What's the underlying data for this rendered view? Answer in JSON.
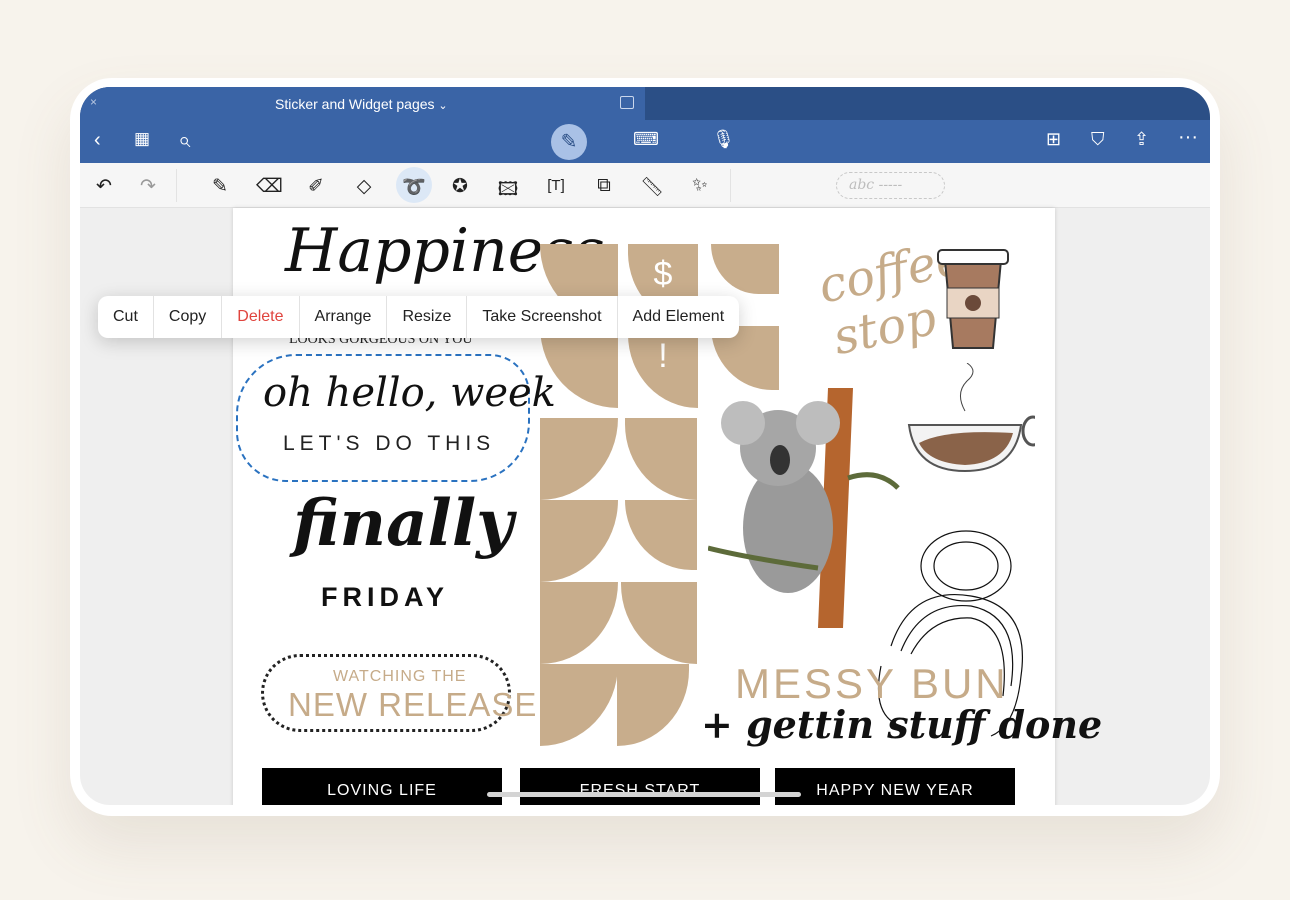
{
  "window": {
    "title": "Sticker and Widget pages",
    "title_chevron": "⌄",
    "close": "×"
  },
  "colors": {
    "header_blue": "#3a64a6",
    "titlebar_dark": "#2b4f86",
    "accent_tan": "#c8ad8c",
    "delete_red": "#e0443e"
  },
  "navbar": {
    "icons": [
      "back-icon",
      "grid-icon",
      "search-icon",
      "pen-write-icon",
      "keyboard-icon",
      "microphone-icon",
      "new-page-icon",
      "bookmark-icon",
      "share-icon",
      "more-icon"
    ]
  },
  "toolbar": {
    "tools": [
      "undo",
      "redo",
      "pen",
      "eraser",
      "highlighter",
      "shapes",
      "lasso",
      "sticker",
      "image",
      "text-box",
      "image-search",
      "ruler",
      "laser-pointer"
    ],
    "handwriting_placeholder": "abc -----"
  },
  "context_menu": {
    "items": [
      "Cut",
      "Copy",
      "Delete",
      "Arrange",
      "Resize",
      "Take Screenshot",
      "Add Element"
    ]
  },
  "page": {
    "happiness": "Happiness",
    "looks": "LOOKS GORGEOUS ON YOU",
    "hello": "oh hello, week",
    "lets": "LET'S DO THIS",
    "finally": "finally",
    "friday": "FRIDAY",
    "watching": "WATCHING THE",
    "release": "NEW RELEASE",
    "coffee": "coffee",
    "stop": "stop",
    "messy": "MESSY BUN",
    "gettin": "+ gettin stuff done",
    "dollar": "$",
    "bang": "!",
    "banners": [
      "LOVING LIFE",
      "FRESH START",
      "HAPPY NEW YEAR"
    ]
  }
}
